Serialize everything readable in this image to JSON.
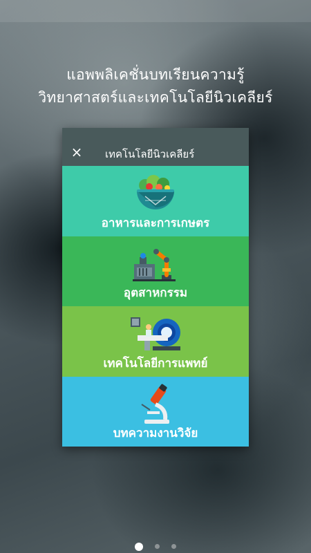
{
  "headline": {
    "line1": "แอพพลิเคชั่นบทเรียนความรู้",
    "line2": "วิทยาศาสตร์และเทคโนโลยีนิวเคลียร์"
  },
  "card": {
    "close_label": "×",
    "title": "เทคโนโลยีนิวเคลียร์",
    "header_color": "#495a5b",
    "tiles": [
      {
        "label": "อาหารและการเกษตร",
        "color": "#3ecba9",
        "icon": "food-bowl-icon"
      },
      {
        "label": "อุตสาหกรรม",
        "color": "#3ab758",
        "icon": "robot-arm-icon"
      },
      {
        "label": "เทคโนโลยีการแพทย์",
        "color": "#7ac349",
        "icon": "mri-scanner-icon"
      },
      {
        "label": "บทความงานวิจัย",
        "color": "#3bbfe2",
        "icon": "microscope-icon"
      }
    ]
  },
  "pager": {
    "pages": 3,
    "active": 1
  }
}
